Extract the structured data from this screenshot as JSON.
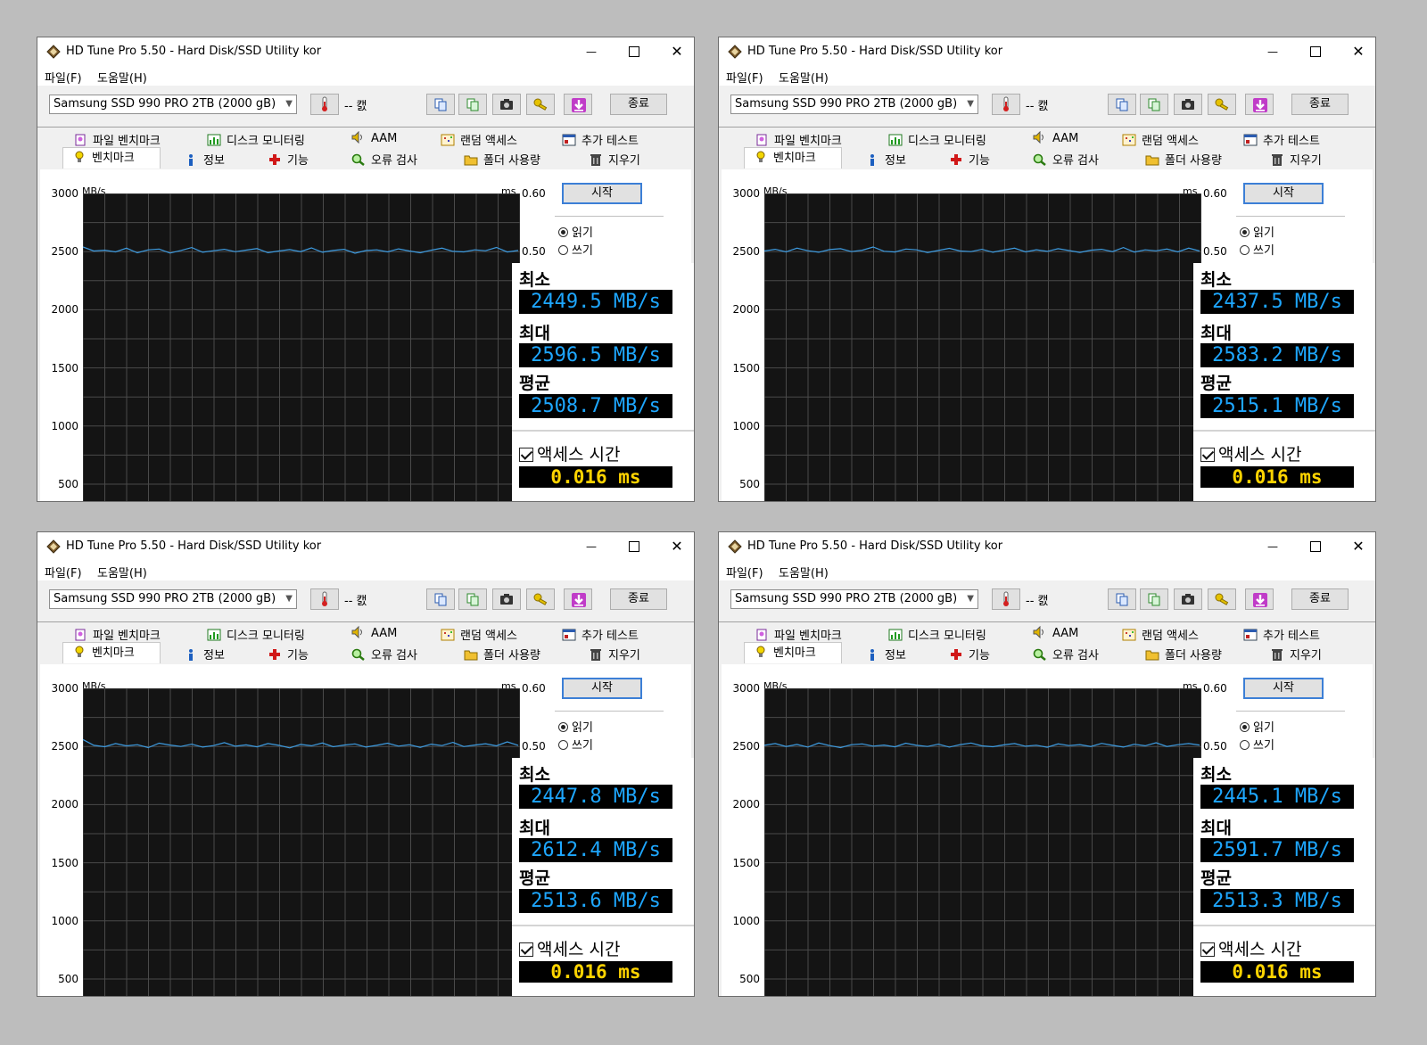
{
  "app": {
    "title": "HD Tune Pro 5.50 - Hard Disk/SSD Utility kor",
    "menu": [
      "파일(F)",
      "도움말(H)"
    ],
    "drive": "Samsung SSD 990 PRO 2TB (2000 gB)",
    "temperature": "-- 캜",
    "exit_label": "종료",
    "tabs_row1": [
      "파일 벤치마크",
      "디스크 모니터링",
      "AAM",
      "랜덤 액세스",
      "추가 테스트"
    ],
    "tabs_row2": [
      "벤치마크",
      "정보",
      "기능",
      "오류 검사",
      "폴더 사용량",
      "지우기"
    ],
    "start_label": "시작",
    "read_label": "읽기",
    "write_label": "쓰기",
    "min_label": "최소",
    "max_label": "최대",
    "avg_label": "평균",
    "access_label": "액세스 시간",
    "y_unit": "MB/s",
    "y2_unit": "ms",
    "y_ticks": [
      "3000",
      "2500",
      "2000",
      "1500",
      "1000",
      "500"
    ],
    "y2_ticks": [
      "0.60",
      "0.50"
    ]
  },
  "windows": [
    {
      "min": "2449.5 MB/s",
      "max": "2596.5 MB/s",
      "avg": "2508.7 MB/s",
      "access": "0.016 ms"
    },
    {
      "min": "2437.5 MB/s",
      "max": "2583.2 MB/s",
      "avg": "2515.1 MB/s",
      "access": "0.016 ms"
    },
    {
      "min": "2447.8 MB/s",
      "max": "2612.4 MB/s",
      "avg": "2513.6 MB/s",
      "access": "0.016 ms"
    },
    {
      "min": "2445.1 MB/s",
      "max": "2591.7 MB/s",
      "avg": "2513.3 MB/s",
      "access": "0.016 ms"
    }
  ],
  "chart_data": [
    {
      "type": "line",
      "ylabel": "MB/s",
      "ylim": [
        500,
        3000
      ],
      "series": [
        {
          "values": [
            2540,
            2505,
            2512,
            2498,
            2530,
            2490,
            2515,
            2522,
            2488,
            2510,
            2535,
            2495,
            2508,
            2520,
            2499,
            2513,
            2526,
            2491,
            2505,
            2518,
            2500,
            2532,
            2495,
            2510,
            2520,
            2486,
            2509,
            2515,
            2498,
            2524,
            2505,
            2490,
            2512,
            2530,
            2502,
            2498,
            2515,
            2508,
            2536,
            2497,
            2510
          ]
        }
      ]
    },
    {
      "type": "line",
      "ylabel": "MB/s",
      "ylim": [
        500,
        3000
      ],
      "series": [
        {
          "values": [
            2505,
            2520,
            2498,
            2530,
            2508,
            2495,
            2518,
            2525,
            2500,
            2512,
            2540,
            2503,
            2497,
            2522,
            2515,
            2492,
            2510,
            2528,
            2505,
            2500,
            2520,
            2495,
            2513,
            2530,
            2498,
            2516,
            2502,
            2525,
            2509,
            2493,
            2512,
            2520,
            2500,
            2535,
            2496,
            2515,
            2507,
            2522,
            2498,
            2530,
            2505
          ]
        }
      ]
    },
    {
      "type": "line",
      "ylabel": "MB/s",
      "ylim": [
        500,
        3000
      ],
      "series": [
        {
          "values": [
            2560,
            2510,
            2498,
            2525,
            2505,
            2515,
            2490,
            2528,
            2512,
            2500,
            2520,
            2495,
            2508,
            2533,
            2502,
            2514,
            2497,
            2525,
            2510,
            2488,
            2518,
            2506,
            2530,
            2498,
            2512,
            2522,
            2495,
            2510,
            2528,
            2503,
            2515,
            2492,
            2520,
            2508,
            2535,
            2499,
            2512,
            2524,
            2505,
            2540,
            2510
          ]
        }
      ]
    },
    {
      "type": "line",
      "ylabel": "MB/s",
      "ylim": [
        500,
        3000
      ],
      "series": [
        {
          "values": [
            2510,
            2525,
            2500,
            2518,
            2495,
            2530,
            2508,
            2490,
            2515,
            2522,
            2503,
            2512,
            2497,
            2528,
            2510,
            2500,
            2520,
            2495,
            2516,
            2530,
            2505,
            2498,
            2514,
            2525,
            2502,
            2511,
            2493,
            2522,
            2508,
            2516,
            2500,
            2527,
            2510,
            2495,
            2519,
            2506,
            2532,
            2500,
            2515,
            2525,
            2512
          ]
        }
      ]
    }
  ]
}
